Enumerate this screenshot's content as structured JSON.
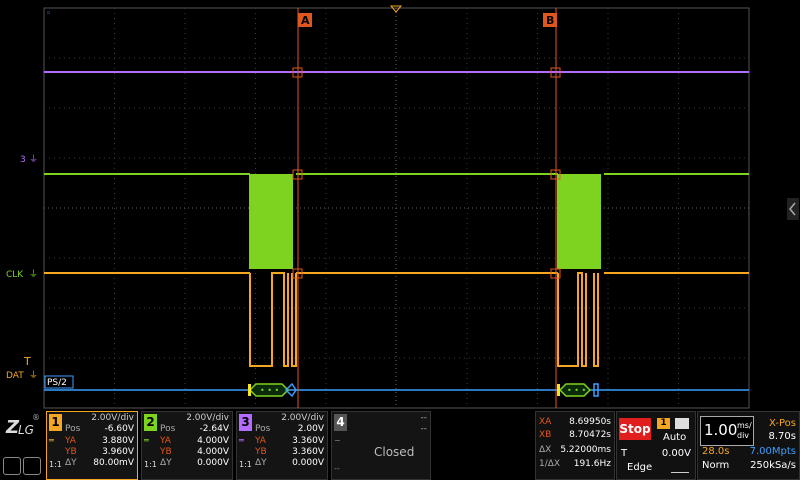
{
  "trace_labels": {
    "ch3": "3",
    "ch2": "CLK",
    "ch1": "DAT",
    "decode": "PS/2"
  },
  "cursors": {
    "a": "A",
    "b": "B"
  },
  "channels": [
    {
      "num": "1",
      "color": "#f5a623",
      "scale": "2.00V/div",
      "pos_label": "Pos",
      "pos": "-6.60V",
      "ya_label": "YA",
      "ya": "3.880V",
      "yb_label": "YB",
      "yb": "3.960V",
      "dy_label": "ΔY",
      "dy": "80.00mV",
      "ratio": "1:1"
    },
    {
      "num": "2",
      "color": "#7ed321",
      "scale": "2.00V/div",
      "pos_label": "Pos",
      "pos": "-2.64V",
      "ya_label": "YA",
      "ya": "4.000V",
      "yb_label": "YB",
      "yb": "4.000V",
      "dy_label": "ΔY",
      "dy": "0.000V",
      "ratio": "1:1"
    },
    {
      "num": "3",
      "color": "#b36cff",
      "scale": "2.00V/div",
      "pos_label": "Pos",
      "pos": "2.00V",
      "ya_label": "YA",
      "ya": "3.360V",
      "yb_label": "YB",
      "yb": "3.360V",
      "dy_label": "ΔY",
      "dy": "0.000V",
      "ratio": "1:1"
    },
    {
      "num": "4",
      "color": "#555555",
      "scale": "--",
      "pos_label": "",
      "pos": "--",
      "status": "Closed",
      "dash": "--",
      "dash2": "--"
    }
  ],
  "measure": {
    "xa_label": "XA",
    "xa": "8.69950s",
    "xb_label": "XB",
    "xb": "8.70472s",
    "dx_label": "ΔX",
    "dx": "5.22000ms",
    "inv_label": "1/ΔX",
    "inv": "191.6Hz"
  },
  "trigger": {
    "state": "Stop",
    "source": "1",
    "mode": "Auto",
    "t_label": "T",
    "level": "0.00V",
    "type": "Edge"
  },
  "timebase": {
    "scale": "1.00",
    "unit_top": "ms/",
    "unit_bot": "div",
    "xpos_label": "X-Pos",
    "xpos": "8.70s",
    "elapsed": "28.0s",
    "mpts": "7.00Mpts",
    "acq_mode": "Norm",
    "rate": "250kSa/s"
  },
  "colors": {
    "ch1": "#f5a623",
    "ch2": "#7ed321",
    "ch3": "#b36cff",
    "cursor": "#e0561f",
    "decode": "#3aa0ff",
    "stop": "#e01e1e"
  }
}
